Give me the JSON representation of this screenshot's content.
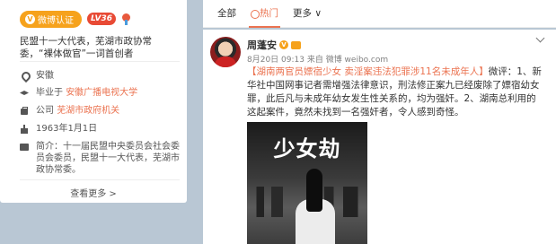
{
  "profile": {
    "vip_label": "微博认证",
    "level_label": "LV36",
    "intro": "民盟十一大代表，芜湖市政协常委，“裸体做官”一词首创者",
    "location": "安徽",
    "education_prefix": "毕业于",
    "education_school": "安徽广播电视大学",
    "company_prefix": "公司",
    "company_name": "芜湖市政府机关",
    "birthday": "1963年1月1日",
    "bio": "简介：十一届民盟中央委员会社会委员会委员，民盟十一大代表，芜湖市政协常委。",
    "more_label": "查看更多 >"
  },
  "tabs": [
    {
      "label": "全部"
    },
    {
      "label": "热门"
    },
    {
      "label": "更多 ∨"
    }
  ],
  "post": {
    "author": "周蓬安",
    "meta": "8月20日 09:13 来自 微博 weibo.com",
    "topic": "【湖南两官员嫖宿少女 卖淫案违法犯罪涉11名未成年人】",
    "content": "微评：1、新华社中国网事记者需增强法律意识，刑法修正案九已经废除了嫖宿幼女罪，此后凡与未成年幼女发生性关系的，均为强奸。2、湖南总利用的这起案件，竟然未找到一名强奸者，令人感到奇怪。",
    "image_title": "少女劫"
  },
  "colors": {
    "accent": "#eb7350",
    "vip": "#f6a21c",
    "level": "#e84a35",
    "page_bg": "#b9c7d4"
  }
}
